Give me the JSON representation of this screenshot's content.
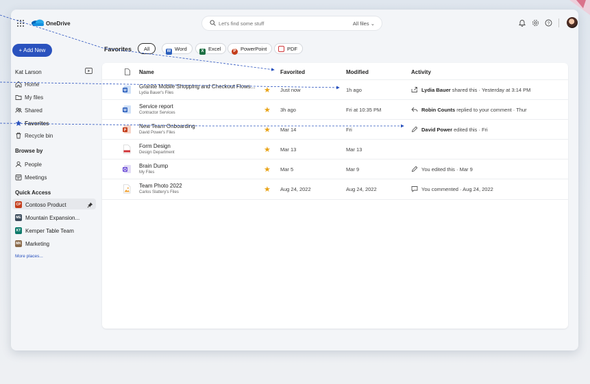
{
  "app": {
    "name": "OneDrive"
  },
  "search": {
    "placeholder": "Let's find some stuff",
    "scope": "All files"
  },
  "add_new": {
    "label": "+ Add New"
  },
  "favorites": {
    "title": "Favorites",
    "filters": [
      {
        "label": "All",
        "active": true
      },
      {
        "label": "Word",
        "icon": "word-icon",
        "color": "#2b5fbd"
      },
      {
        "label": "Excel",
        "icon": "excel-icon",
        "color": "#1d7044"
      },
      {
        "label": "PowerPoint",
        "icon": "powerpoint-icon",
        "color": "#c43e1c"
      },
      {
        "label": "PDF",
        "icon": "pdf-icon",
        "color": "#d13438"
      }
    ]
  },
  "sidebar": {
    "user": "Kat Larson",
    "nav": [
      {
        "label": "Home",
        "icon": "home-icon"
      },
      {
        "label": "My files",
        "icon": "folder-icon"
      },
      {
        "label": "Shared",
        "icon": "people-icon"
      },
      {
        "label": "Favorites",
        "icon": "star-icon",
        "active": true
      },
      {
        "label": "Recycle bin",
        "icon": "trash-icon"
      }
    ],
    "browse_by": {
      "title": "Browse by",
      "items": [
        {
          "label": "People",
          "icon": "person-icon"
        },
        {
          "label": "Meetings",
          "icon": "calendar-icon"
        }
      ]
    },
    "quick_access": {
      "title": "Quick Access",
      "items": [
        {
          "label": "Contoso Product",
          "badge": "CP",
          "color": "#c43e1c",
          "pinned": true
        },
        {
          "label": "Mountain Expansion...",
          "badge": "ME",
          "color": "#3a4a5a"
        },
        {
          "label": "Kemper Table Team",
          "badge": "KT",
          "color": "#0f7b6c"
        },
        {
          "label": "Marketing",
          "badge": "MK",
          "color": "#8a6a4a"
        }
      ],
      "more": "More places..."
    }
  },
  "table": {
    "headers": {
      "name": "Name",
      "favorited": "Favorited",
      "modified": "Modified",
      "activity": "Activity"
    },
    "rows": [
      {
        "name": "Granite Mobile Shopping and Checkout Flows...",
        "location": "Lydia Bauer's Files",
        "type": "word",
        "favorited": "Just now",
        "modified": "1h ago",
        "activity_icon": "share-icon",
        "actor": "Lydia Bauer",
        "activity": " shared this · Yesterday at 3:14 PM"
      },
      {
        "name": "Service report",
        "location": "Contractor Services",
        "type": "word",
        "favorited": "3h ago",
        "modified": "Fri at 10:35 PM",
        "activity_icon": "reply-icon",
        "actor": "Robin Counts",
        "activity": " replied to your comment · Thur"
      },
      {
        "name": "New Team Onboarding",
        "location": "David Power's Files",
        "type": "powerpoint",
        "favorited": "Mar 14",
        "modified": "Fri",
        "activity_icon": "edit-icon",
        "actor": "David Power",
        "activity": " edited this · Fri"
      },
      {
        "name": "Form Design",
        "location": "Design Department",
        "type": "pdf",
        "favorited": "Mar 13",
        "modified": "Mar 13",
        "activity_icon": "",
        "actor": "",
        "activity": ""
      },
      {
        "name": "Brain Dump",
        "location": "My Files",
        "type": "loop",
        "favorited": "Mar 5",
        "modified": "Mar 9",
        "activity_icon": "edit-icon",
        "actor": "",
        "activity": "You edited this · Mar 9"
      },
      {
        "name": "Team Photo 2022",
        "location": "Carlos Slattery's Files",
        "type": "image",
        "favorited": "Aug 24, 2022",
        "modified": "Aug 24, 2022",
        "activity_icon": "comment-icon",
        "actor": "",
        "activity": "You commented · Aug 24, 2022"
      }
    ]
  }
}
